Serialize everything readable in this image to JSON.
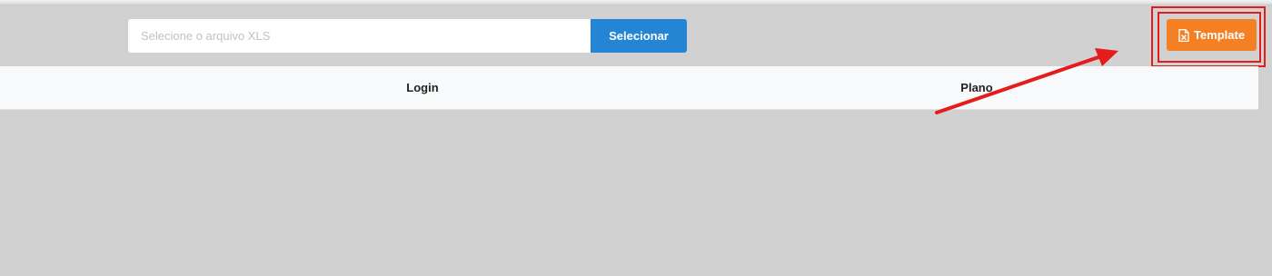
{
  "upload": {
    "placeholder": "Selecione o arquivo XLS",
    "select_label": "Selecionar"
  },
  "template_button": {
    "label": "Template",
    "icon": "file-excel-icon"
  },
  "table": {
    "columns": [
      "Login",
      "Plano"
    ]
  },
  "colors": {
    "background": "#d1d1d1",
    "primary_button": "#2385d3",
    "template_button": "#f48023",
    "annotation": "#e31c1c",
    "table_header": "#f8f9fa"
  }
}
